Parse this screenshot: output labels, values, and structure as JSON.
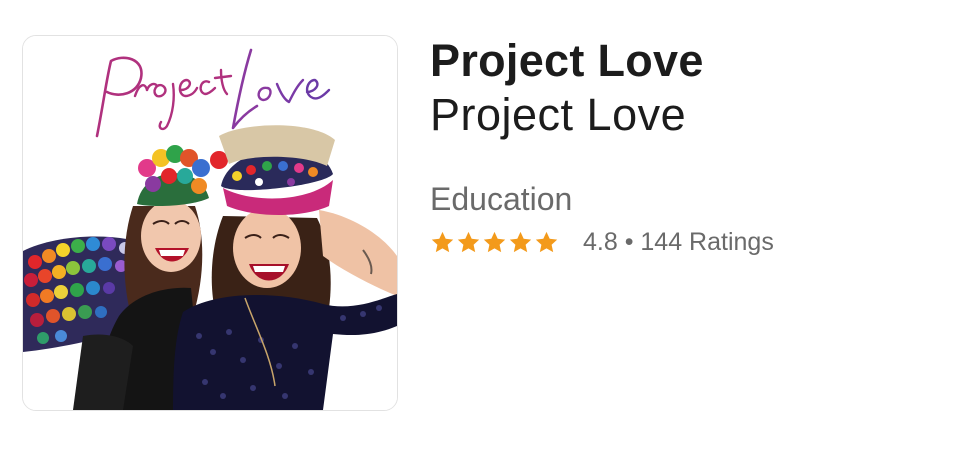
{
  "podcast": {
    "title": "Project Love",
    "author": "Project Love",
    "category": "Education",
    "artwork_text": "Project Love",
    "rating": {
      "value": 4.8,
      "stars_filled": 5,
      "stars_total": 5,
      "text": "4.8 • 144 Ratings",
      "star_color": "#f39a1b"
    }
  },
  "icons": {
    "star": "star-icon"
  }
}
